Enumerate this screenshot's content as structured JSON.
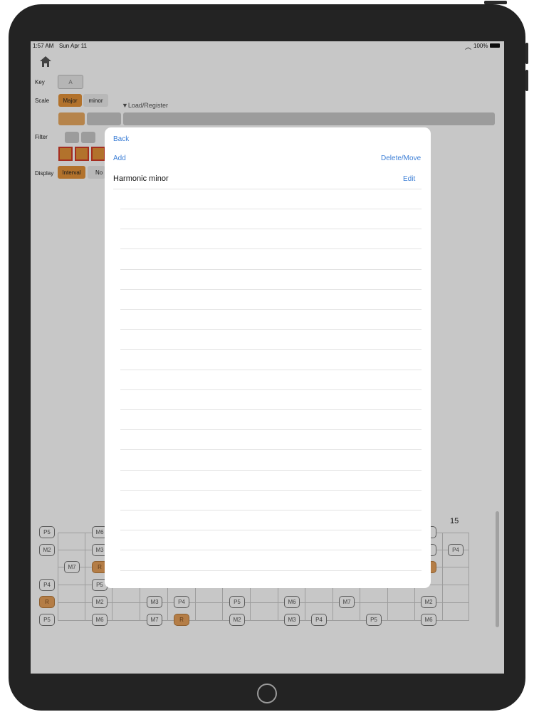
{
  "status_bar": {
    "time": "1:57 AM",
    "date": "Sun Apr 11",
    "battery": "100%"
  },
  "controls": {
    "key_label": "Key",
    "key_value": "A",
    "scale_label": "Scale",
    "scale_major": "Major",
    "scale_minor": "minor",
    "load_register": "▼Load/Register",
    "filter_label": "Filter",
    "display_label": "Display",
    "display_interval": "Interval",
    "display_note": "No"
  },
  "modal": {
    "back": "Back",
    "add": "Add",
    "delete_move": "Delete/Move",
    "items": [
      {
        "title": "Harmonic minor",
        "action": "Edit"
      }
    ]
  },
  "fretboard": {
    "fret_number": "15",
    "row1": {
      "notes": [
        "P5",
        "M6",
        "3"
      ]
    },
    "row2": {
      "notes": [
        "M2",
        "M3",
        "3",
        "P4"
      ]
    },
    "row3": {
      "notes": [
        "M7",
        "R"
      ]
    },
    "row4": {
      "notes": [
        "P4",
        "P5"
      ]
    },
    "row5": {
      "notes": [
        "R",
        "M2",
        "M3",
        "P4",
        "P5",
        "M6",
        "M7",
        "M2"
      ]
    },
    "row6": {
      "notes": [
        "P5",
        "M6",
        "M7",
        "R",
        "M2",
        "M3",
        "P4",
        "P5",
        "M6"
      ]
    }
  },
  "colors": {
    "accent": "#e59339",
    "link": "#3d7fd6",
    "filter_border": "#d43a2a"
  }
}
